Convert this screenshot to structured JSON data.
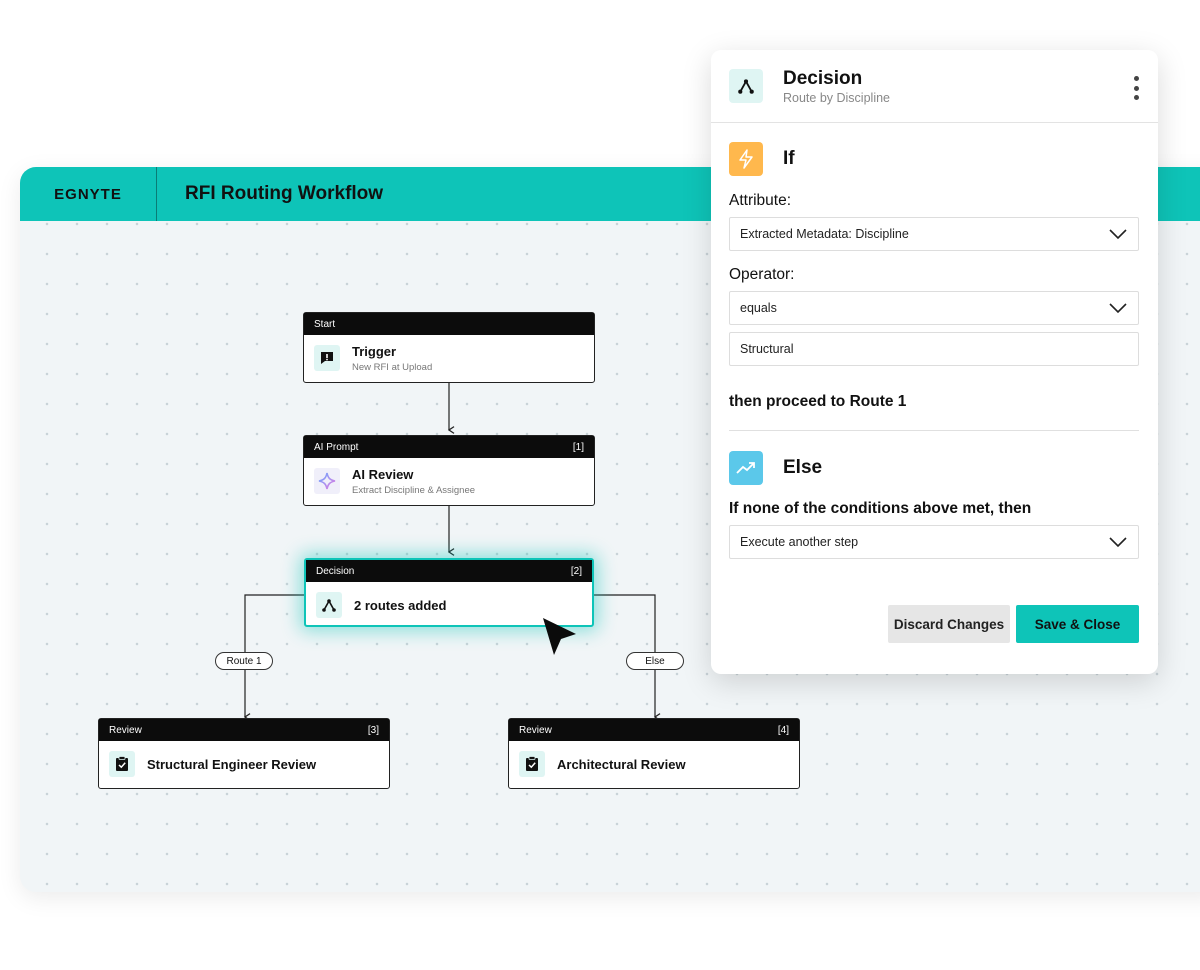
{
  "brand": "EGNYTE",
  "workflow_title": "RFI Routing Workflow",
  "nodes": {
    "start": {
      "type": "Start",
      "badge": "",
      "title": "Trigger",
      "subtitle": "New RFI at Upload"
    },
    "ai": {
      "type": "AI Prompt",
      "badge": "[1]",
      "title": "AI Review",
      "subtitle": "Extract Discipline & Assignee"
    },
    "decision": {
      "type": "Decision",
      "badge": "[2]",
      "title": "2 routes added"
    },
    "review1": {
      "type": "Review",
      "badge": "[3]",
      "title": "Structural Engineer Review"
    },
    "review2": {
      "type": "Review",
      "badge": "[4]",
      "title": "Architectural Review"
    }
  },
  "edges": {
    "route1": "Route 1",
    "else": "Else"
  },
  "panel": {
    "title": "Decision",
    "subtitle": "Route by Discipline",
    "if_label": "If",
    "attribute_label": "Attribute:",
    "attribute_value": "Extracted Metadata: Discipline",
    "operator_label": "Operator:",
    "operator_value": "equals",
    "value_input": "Structural",
    "then_text": "then proceed to Route 1",
    "else_label": "Else",
    "else_text": "If none of the conditions above met, then",
    "else_value": "Execute another step",
    "discard": "Discard Changes",
    "save": "Save & Close"
  },
  "colors": {
    "accent": "#0ec4b8",
    "if_icon": "#ffb84d",
    "else_icon": "#5bc8ea"
  }
}
